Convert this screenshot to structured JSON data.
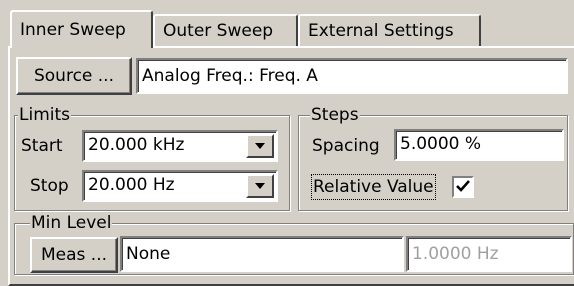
{
  "tabs": [
    {
      "label": "Inner Sweep",
      "active": true
    },
    {
      "label": "Outer Sweep",
      "active": false
    },
    {
      "label": "External Settings",
      "active": false
    }
  ],
  "source": {
    "button_label": "Source ...",
    "value": "Analog Freq.: Freq. A"
  },
  "limits": {
    "legend": "Limits",
    "start_label": "Start",
    "start_value": "20.000 kHz",
    "stop_label": "Stop",
    "stop_value": "20.000 Hz"
  },
  "steps": {
    "legend": "Steps",
    "spacing_label": "Spacing",
    "spacing_value": "5.0000 %",
    "relative_label": "Relative Value",
    "relative_checked": true
  },
  "min_level": {
    "legend": "Min Level",
    "button_label": "Meas ...",
    "value": "None",
    "disabled_value": "1.0000 Hz"
  },
  "icons": {
    "dropdown": "chevron-down-icon",
    "check": "checkmark-icon"
  }
}
